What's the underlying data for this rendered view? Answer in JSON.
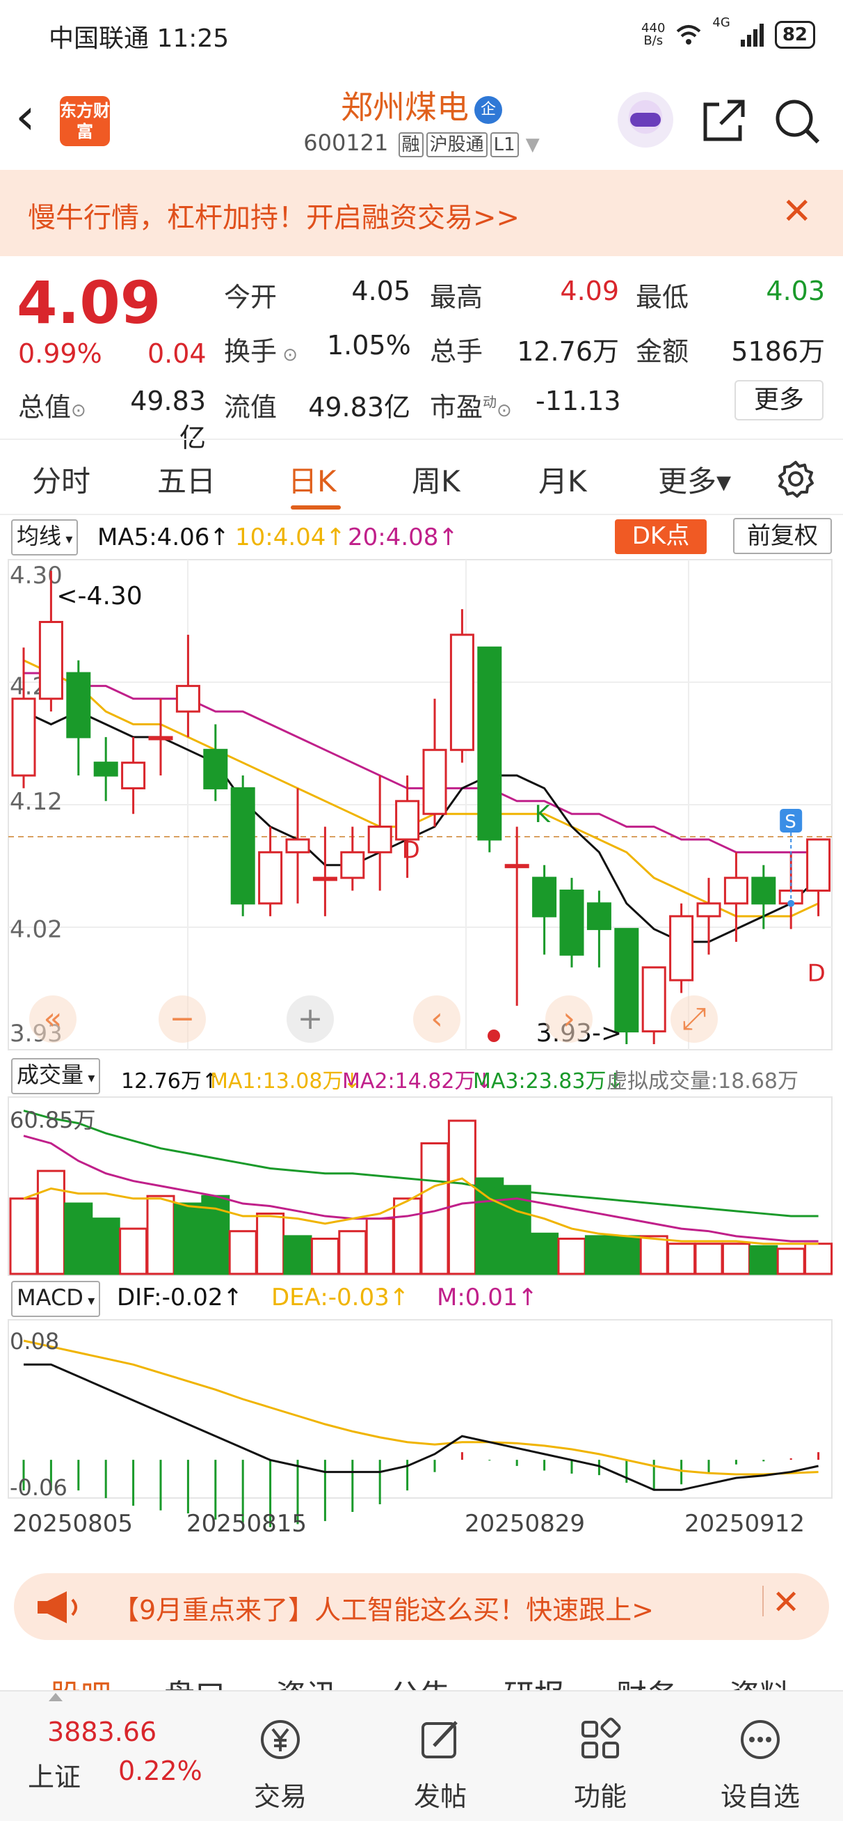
{
  "status_bar": {
    "carrier_time": "中国联通 11:25",
    "net_speed": "440\nB/s",
    "battery": "82",
    "signal": "4G"
  },
  "header": {
    "title": "郑州煤电",
    "ent_badge": "企",
    "code": "600121",
    "tags": [
      "融",
      "沪股通",
      "L1"
    ],
    "logo_text": "东方财富"
  },
  "banner": {
    "text": "慢牛行情，杠杆加持！开启融资交易>>"
  },
  "quote": {
    "price": "4.09",
    "pct": "0.99%",
    "change": "0.04",
    "open_label": "今开",
    "open": "4.05",
    "high_label": "最高",
    "high": "4.09",
    "low_label": "最低",
    "low": "4.03",
    "turnover_label": "换手",
    "turnover": "1.05%",
    "volume_label": "总手",
    "volume": "12.76万",
    "amount_label": "金额",
    "amount": "5186万",
    "mcap_label": "总值",
    "mcap": "49.83亿",
    "float_label": "流值",
    "float": "49.83亿",
    "pe_label": "市盈",
    "pe_sup": "动",
    "pe": "-11.13",
    "more": "更多"
  },
  "tabs": [
    "分时",
    "五日",
    "日K",
    "周K",
    "月K",
    "更多▾"
  ],
  "active_tab": "日K",
  "ma_row": {
    "selector": "均线",
    "ma5": "MA5:4.06↑",
    "ma10": "10:4.04↑",
    "ma20": "20:4.08↑",
    "dk": "DK点",
    "fq": "前复权"
  },
  "vol_row": {
    "selector": "成交量",
    "vol": "12.76万↑",
    "ma1": "MA1:13.08万↓",
    "ma2": "MA2:14.82万↓",
    "ma3": "MA3:23.83万↓",
    "virtual": "虚拟成交量:18.68万"
  },
  "macd_row": {
    "selector": "MACD",
    "dif": "DIF:-0.02↑",
    "dea": "DEA:-0.03↑",
    "m": "M:0.01↑"
  },
  "colors": {
    "up": "#d9262c",
    "down": "#1a9a2a",
    "ma5": "#111111",
    "ma10": "#f0b400",
    "ma20": "#c0208a",
    "accent": "#e0601c"
  },
  "chart_data": [
    {
      "type": "candlestick",
      "y_ticks": [
        "4.30",
        "4.21",
        "4.12",
        "4.02",
        "3.93"
      ],
      "ylim": [
        3.93,
        4.3
      ],
      "annotations": [
        "<-4.30",
        "3.93->",
        "D",
        "K",
        "D",
        "S"
      ],
      "candles": [
        {
          "o": 4.14,
          "c": 4.2,
          "h": 4.24,
          "l": 4.13
        },
        {
          "o": 4.2,
          "c": 4.26,
          "h": 4.3,
          "l": 4.19
        },
        {
          "o": 4.22,
          "c": 4.17,
          "h": 4.23,
          "l": 4.14
        },
        {
          "o": 4.15,
          "c": 4.14,
          "h": 4.17,
          "l": 4.12
        },
        {
          "o": 4.13,
          "c": 4.15,
          "h": 4.17,
          "l": 4.11
        },
        {
          "o": 4.17,
          "c": 4.17,
          "h": 4.2,
          "l": 4.14
        },
        {
          "o": 4.19,
          "c": 4.21,
          "h": 4.25,
          "l": 4.17
        },
        {
          "o": 4.16,
          "c": 4.13,
          "h": 4.18,
          "l": 4.12
        },
        {
          "o": 4.13,
          "c": 4.04,
          "h": 4.14,
          "l": 4.03
        },
        {
          "o": 4.04,
          "c": 4.08,
          "h": 4.1,
          "l": 4.03
        },
        {
          "o": 4.08,
          "c": 4.09,
          "h": 4.13,
          "l": 4.04
        },
        {
          "o": 4.06,
          "c": 4.06,
          "h": 4.1,
          "l": 4.03
        },
        {
          "o": 4.06,
          "c": 4.08,
          "h": 4.1,
          "l": 4.05
        },
        {
          "o": 4.08,
          "c": 4.1,
          "h": 4.14,
          "l": 4.05
        },
        {
          "o": 4.09,
          "c": 4.12,
          "h": 4.14,
          "l": 4.06
        },
        {
          "o": 4.11,
          "c": 4.16,
          "h": 4.2,
          "l": 4.1
        },
        {
          "o": 4.16,
          "c": 4.25,
          "h": 4.27,
          "l": 4.15
        },
        {
          "o": 4.24,
          "c": 4.09,
          "h": 4.24,
          "l": 4.08
        },
        {
          "o": 4.07,
          "c": 4.07,
          "h": 4.1,
          "l": 3.96
        },
        {
          "o": 4.06,
          "c": 4.03,
          "h": 4.07,
          "l": 4.0
        },
        {
          "o": 4.05,
          "c": 4.0,
          "h": 4.06,
          "l": 3.99
        },
        {
          "o": 4.04,
          "c": 4.02,
          "h": 4.05,
          "l": 3.99
        },
        {
          "o": 4.02,
          "c": 3.94,
          "h": 4.02,
          "l": 3.93
        },
        {
          "o": 3.94,
          "c": 3.99,
          "h": 3.99,
          "l": 3.93
        },
        {
          "o": 3.98,
          "c": 4.03,
          "h": 4.04,
          "l": 3.97
        },
        {
          "o": 4.03,
          "c": 4.04,
          "h": 4.06,
          "l": 4.0
        },
        {
          "o": 4.04,
          "c": 4.06,
          "h": 4.08,
          "l": 4.01
        },
        {
          "o": 4.06,
          "c": 4.04,
          "h": 4.07,
          "l": 4.02
        },
        {
          "o": 4.04,
          "c": 4.05,
          "h": 4.08,
          "l": 4.02
        },
        {
          "o": 4.05,
          "c": 4.09,
          "h": 4.09,
          "l": 4.03
        }
      ],
      "ma5": [
        4.19,
        4.18,
        4.19,
        4.18,
        4.17,
        4.17,
        4.16,
        4.15,
        4.12,
        4.1,
        4.09,
        4.07,
        4.07,
        4.08,
        4.09,
        4.1,
        4.13,
        4.14,
        4.14,
        4.13,
        4.1,
        4.08,
        4.04,
        4.02,
        4.01,
        4.01,
        4.02,
        4.03,
        4.04,
        4.06
      ],
      "ma10": [
        4.23,
        4.22,
        4.21,
        4.19,
        4.18,
        4.18,
        4.17,
        4.16,
        4.15,
        4.14,
        4.13,
        4.12,
        4.11,
        4.1,
        4.1,
        4.11,
        4.11,
        4.11,
        4.11,
        4.11,
        4.1,
        4.09,
        4.08,
        4.06,
        4.05,
        4.04,
        4.03,
        4.03,
        4.03,
        4.04
      ],
      "ma20": [
        4.22,
        4.22,
        4.21,
        4.21,
        4.2,
        4.2,
        4.2,
        4.19,
        4.19,
        4.18,
        4.17,
        4.16,
        4.15,
        4.14,
        4.13,
        4.13,
        4.13,
        4.13,
        4.12,
        4.12,
        4.11,
        4.11,
        4.1,
        4.1,
        4.09,
        4.09,
        4.08,
        4.08,
        4.08,
        4.08
      ]
    },
    {
      "type": "bar",
      "y_max_label": "60.85万",
      "volumes": [
        30,
        41,
        28,
        22,
        18,
        31,
        28,
        31,
        17,
        24,
        15,
        14,
        17,
        22,
        30,
        52,
        61,
        38,
        35,
        16,
        14,
        15,
        15,
        15,
        12,
        12,
        12,
        11,
        10,
        12
      ],
      "up": [
        true,
        true,
        false,
        false,
        true,
        true,
        false,
        false,
        true,
        true,
        false,
        true,
        true,
        true,
        true,
        true,
        true,
        false,
        false,
        false,
        true,
        false,
        false,
        true,
        true,
        true,
        true,
        false,
        true,
        true
      ],
      "ma1": [
        30,
        34,
        32,
        32,
        30,
        30,
        27,
        26,
        23,
        23,
        22,
        20,
        22,
        24,
        29,
        35,
        38,
        30,
        25,
        22,
        18,
        16,
        15,
        14,
        13,
        13,
        13,
        12,
        12,
        12
      ],
      "ma2": [
        55,
        52,
        45,
        40,
        37,
        35,
        33,
        31,
        28,
        27,
        25,
        23,
        22,
        22,
        23,
        25,
        28,
        29,
        30,
        28,
        26,
        24,
        22,
        20,
        18,
        17,
        15,
        14,
        13,
        13
      ],
      "ma3": [
        65,
        62,
        60,
        56,
        53,
        50,
        48,
        46,
        44,
        42,
        41,
        40,
        40,
        39,
        38,
        37,
        36,
        34,
        33,
        32,
        31,
        30,
        29,
        28,
        27,
        26,
        25,
        24,
        23,
        23
      ]
    },
    {
      "type": "macd",
      "y_ticks": [
        "0.08",
        "-0.06"
      ],
      "x_ticks": [
        "20250805",
        "20250815",
        "20250829",
        "20250912"
      ],
      "ylim": [
        -0.06,
        0.08
      ],
      "dif": [
        0.06,
        0.06,
        0.05,
        0.04,
        0.03,
        0.02,
        0.01,
        0.0,
        -0.01,
        -0.02,
        -0.025,
        -0.03,
        -0.03,
        -0.03,
        -0.025,
        -0.015,
        0.0,
        -0.005,
        -0.01,
        -0.015,
        -0.02,
        -0.025,
        -0.035,
        -0.045,
        -0.045,
        -0.04,
        -0.035,
        -0.033,
        -0.03,
        -0.025
      ],
      "dea": [
        0.08,
        0.075,
        0.07,
        0.065,
        0.06,
        0.053,
        0.046,
        0.039,
        0.031,
        0.024,
        0.017,
        0.01,
        0.004,
        -0.001,
        -0.005,
        -0.007,
        -0.005,
        -0.005,
        -0.006,
        -0.008,
        -0.011,
        -0.015,
        -0.02,
        -0.025,
        -0.029,
        -0.031,
        -0.032,
        -0.032,
        -0.031,
        -0.03
      ],
      "m": [
        -0.04,
        -0.04,
        -0.04,
        -0.05,
        -0.06,
        -0.066,
        -0.07,
        -0.078,
        -0.082,
        -0.088,
        -0.084,
        -0.08,
        -0.068,
        -0.058,
        -0.04,
        -0.016,
        0.01,
        -0.001,
        -0.008,
        -0.014,
        -0.018,
        -0.02,
        -0.03,
        -0.04,
        -0.032,
        -0.018,
        -0.006,
        -0.002,
        0.002,
        0.01
      ]
    }
  ],
  "controls": [
    "«",
    "−",
    "+",
    "‹",
    "›",
    "⤢"
  ],
  "promo2": {
    "text": "【9月重点来了】人工智能这么买！快速跟上>"
  },
  "lower_tabs": [
    "股吧",
    "盘口",
    "资讯",
    "公告",
    "研报",
    "财务",
    "资料"
  ],
  "bottom_bar": {
    "index_value": "3883.66",
    "index_name": "上证",
    "index_pct": "0.22%",
    "items": [
      "交易",
      "发帖",
      "功能",
      "设自选"
    ]
  }
}
